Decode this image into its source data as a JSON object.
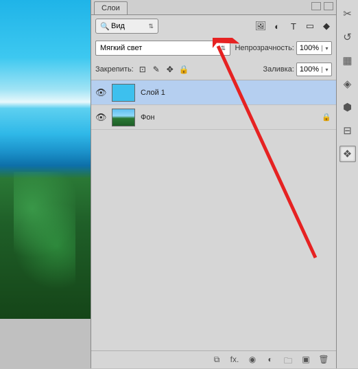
{
  "panel": {
    "tab_title": "Слои",
    "filter_label": "Вид",
    "blend_mode": "Мягкий свет",
    "opacity_label": "Непрозрачность:",
    "opacity_value": "100%",
    "fill_label": "Заливка:",
    "fill_value": "100%",
    "lock_label": "Закрепить:"
  },
  "layers": [
    {
      "name": "Слой 1",
      "visible": true,
      "selected": true,
      "locked": false
    },
    {
      "name": "Фон",
      "visible": true,
      "selected": false,
      "locked": true
    }
  ],
  "icons": {
    "search": "🔍",
    "image": "🖼",
    "adjust": "◐",
    "type": "T",
    "shape": "▭",
    "fx": "◆",
    "box": "⊡",
    "brush": "✎",
    "move": "✥",
    "lock": "🔒",
    "eye": "👁",
    "link": "⧉",
    "fxtxt": "fx.",
    "mask": "◉",
    "adjust2": "◐",
    "folder": "🗀",
    "new": "▣",
    "trash": "🗑",
    "sliders": "✂",
    "hist": "↺",
    "nav": "▦",
    "cube": "◈",
    "swatch": "⬢",
    "node": "⊟",
    "layers_ic": "❖"
  }
}
